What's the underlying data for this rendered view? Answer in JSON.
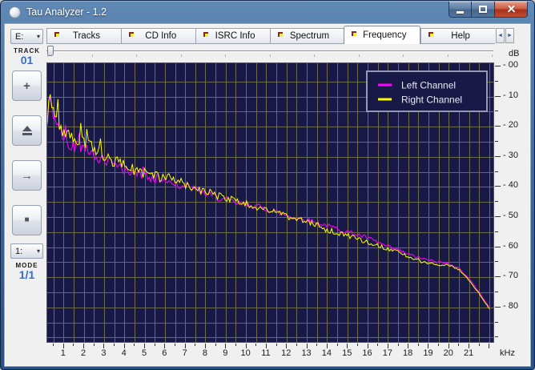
{
  "window": {
    "title": "Tau Analyzer - 1.2",
    "controls": [
      "minimize",
      "maximize",
      "close"
    ]
  },
  "tabs": {
    "items": [
      {
        "label": "Tracks",
        "active": false
      },
      {
        "label": "CD Info",
        "active": false
      },
      {
        "label": "ISRC Info",
        "active": false
      },
      {
        "label": "Spectrum",
        "active": false
      },
      {
        "label": "Frequency",
        "active": true
      },
      {
        "label": "Help",
        "active": false
      }
    ]
  },
  "sidebar": {
    "drive_select": {
      "value": "E:"
    },
    "track_label": "TRACK",
    "track_value": "01",
    "transport_buttons": [
      {
        "name": "plus-button",
        "glyph": "plus"
      },
      {
        "name": "eject-button",
        "glyph": "eject"
      },
      {
        "name": "next-button",
        "glyph": "arrow-right"
      },
      {
        "name": "stop-button",
        "glyph": "square"
      }
    ],
    "speed_select": {
      "value": "1:"
    },
    "mode_label": "MODE",
    "mode_value": "1/1"
  },
  "chart_data": {
    "type": "line",
    "title": "",
    "xlabel": "kHz",
    "ylabel": "dB",
    "background": "#191948",
    "grid": {
      "on": true,
      "color": "#6d6d49",
      "x_step_khz": 0.5,
      "y_step_db": 5
    },
    "x_range_khz": [
      0.2,
      22.2
    ],
    "y_range_db": [
      0,
      -92
    ],
    "x_tick_labels": [
      "1",
      "2",
      "3",
      "4",
      "5",
      "6",
      "7",
      "8",
      "9",
      "10",
      "11",
      "12",
      "13",
      "14",
      "15",
      "16",
      "17",
      "18",
      "19",
      "20",
      "21"
    ],
    "y_tick_labels": [
      "- 00",
      "- 10",
      "- 20",
      "- 30",
      "- 40",
      "- 50",
      "- 60",
      "- 70",
      "- 80"
    ],
    "x_unit_label": "kHz",
    "y_unit_label": "dB",
    "legend": {
      "position": "top-right",
      "entries": [
        {
          "name": "Left Channel",
          "color": "#ff00ff"
        },
        {
          "name": "Right Channel",
          "color": "#ffff00"
        }
      ]
    },
    "x_khz": [
      0.2,
      0.3,
      0.5,
      1,
      1.5,
      2,
      2.5,
      3,
      3.5,
      4,
      4.5,
      5,
      5.5,
      6,
      6.5,
      7,
      7.5,
      8,
      8.5,
      9,
      9.5,
      10,
      10.5,
      11,
      11.5,
      12,
      12.5,
      13,
      13.5,
      14,
      14.5,
      15,
      15.5,
      16,
      16.5,
      17,
      17.5,
      18,
      18.5,
      19,
      19.5,
      20,
      20.5,
      21,
      21.5,
      22
    ],
    "series": [
      {
        "name": "Left Channel",
        "color": "#ff00ff",
        "values_db": [
          -20,
          -10,
          -16,
          -24.5,
          -26.5,
          -27,
          -29.5,
          -31.5,
          -33,
          -34.5,
          -35.5,
          -36.5,
          -37.5,
          -38,
          -39,
          -40,
          -41,
          -42.5,
          -43.5,
          -44.5,
          -45.5,
          -46,
          -46.5,
          -47.5,
          -48.5,
          -49.5,
          -50.5,
          -51,
          -52,
          -53,
          -54,
          -55,
          -56,
          -57,
          -58.5,
          -60,
          -61,
          -62.5,
          -63.5,
          -64.5,
          -65,
          -65.5,
          -67,
          -70.5,
          -75,
          -80
        ]
      },
      {
        "name": "Right Channel",
        "color": "#ffff00",
        "values_db": [
          -19,
          -9.5,
          -14.5,
          -23.5,
          -25,
          -25.5,
          -28,
          -30.5,
          -32,
          -33.5,
          -35,
          -36,
          -37,
          -37.5,
          -38.5,
          -39.5,
          -40.5,
          -42,
          -43,
          -44,
          -45,
          -46,
          -47,
          -48,
          -49,
          -50,
          -51,
          -52,
          -53,
          -54.5,
          -55.5,
          -56.5,
          -57.5,
          -58.5,
          -59.5,
          -61,
          -62,
          -63.5,
          -64.5,
          -65.5,
          -66,
          -66,
          -67.5,
          -71,
          -75.5,
          -80.5
        ]
      }
    ],
    "noise_profile": [
      [
        0.2,
        1.0
      ],
      [
        0.5,
        3.2
      ],
      [
        3.0,
        2.4
      ],
      [
        8.0,
        1.6
      ],
      [
        14.0,
        1.1
      ],
      [
        19.0,
        0.7
      ],
      [
        20.5,
        0.3
      ],
      [
        22.1,
        0.15
      ]
    ],
    "seed": 42
  }
}
